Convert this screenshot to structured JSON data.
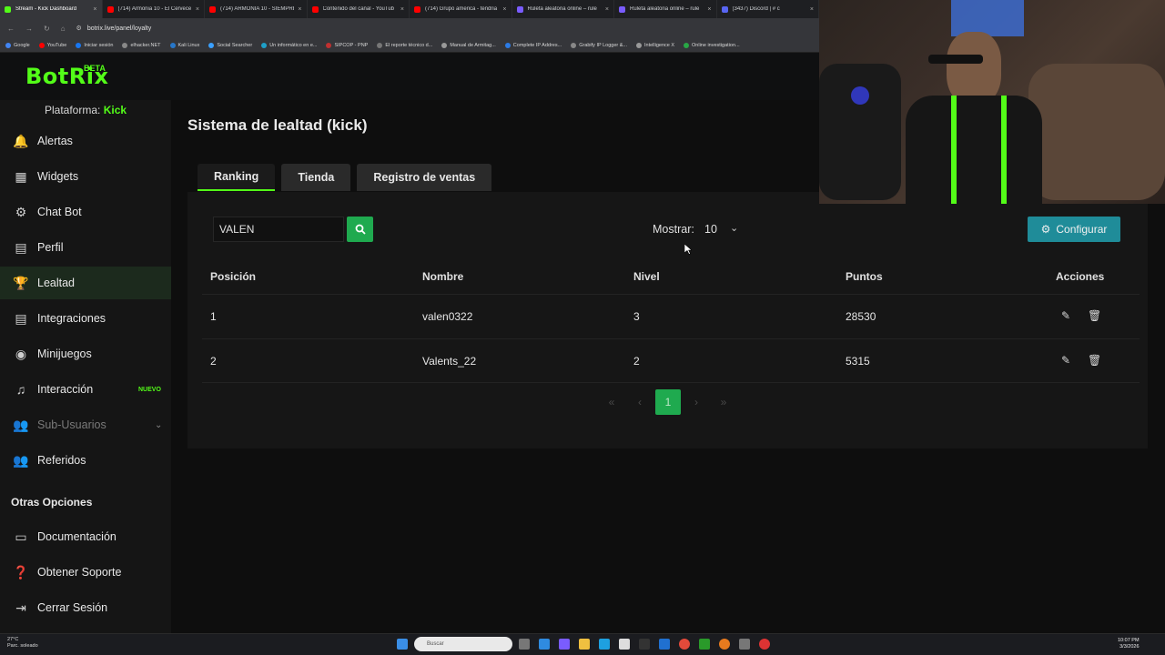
{
  "browser": {
    "tabs": [
      {
        "title": "Stream - Kick Dashboard",
        "color": "#53fc18"
      },
      {
        "title": "(714) Armonia 10 - El Cervece",
        "color": "#ff0000"
      },
      {
        "title": "(714) ARMONIA 10 - SIEMPRE",
        "color": "#ff0000"
      },
      {
        "title": "Contenido del canal - YouTub",
        "color": "#ff0000"
      },
      {
        "title": "(714) Grupo america - tendria",
        "color": "#ff0000"
      },
      {
        "title": "Ruleta aleatoria online – rule",
        "color": "#7a5cff"
      },
      {
        "title": "Ruleta aleatoria online – rule",
        "color": "#7a5cff"
      },
      {
        "title": "(3437) Discord | # c",
        "color": "#5865f2"
      }
    ],
    "url": "botrix.live/panel/loyalty",
    "bookmarks": [
      {
        "label": "Google",
        "color": "#4285f4"
      },
      {
        "label": "YouTube",
        "color": "#ff0000"
      },
      {
        "label": "Iniciar sesión",
        "color": "#1877f2"
      },
      {
        "label": "elhacker.NET",
        "color": "#888888"
      },
      {
        "label": "Kali Linux",
        "color": "#2777c9"
      },
      {
        "label": "Social Searcher",
        "color": "#3aa0ff"
      },
      {
        "label": "Un informático en e...",
        "color": "#1ea0c8"
      },
      {
        "label": "SIPCOP - PNP",
        "color": "#c03030"
      },
      {
        "label": "El reporte técnico d...",
        "color": "#777777"
      },
      {
        "label": "Manual de Armitag...",
        "color": "#999999"
      },
      {
        "label": "Complete IP Addres...",
        "color": "#2c7be5"
      },
      {
        "label": "Grabify IP Logger &...",
        "color": "#888888"
      },
      {
        "label": "Intelligence X",
        "color": "#999999"
      },
      {
        "label": "Online investigation...",
        "color": "#28a745"
      }
    ]
  },
  "app": {
    "logo": "BotRix",
    "logo_badge": "BETA",
    "platform_label": "Plataforma:",
    "platform_value": "Kick"
  },
  "sidebar": {
    "items": [
      {
        "label": "Alertas",
        "icon": "bell-icon",
        "glyph": "🔔"
      },
      {
        "label": "Widgets",
        "icon": "grid-icon",
        "glyph": "▦"
      },
      {
        "label": "Chat Bot",
        "icon": "robot-icon",
        "glyph": "🤖"
      },
      {
        "label": "Perfil",
        "icon": "id-card-icon",
        "glyph": "▤"
      },
      {
        "label": "Lealtad",
        "icon": "trophy-icon",
        "glyph": "🏆"
      },
      {
        "label": "Integraciones",
        "icon": "list-icon",
        "glyph": "▤"
      },
      {
        "label": "Minijuegos",
        "icon": "gamepad-icon",
        "glyph": "🎮"
      },
      {
        "label": "Interacción",
        "icon": "music-icon",
        "glyph": "♫",
        "badge": "NUEVO"
      },
      {
        "label": "Sub-Usuarios",
        "icon": "users-icon",
        "glyph": "👥"
      },
      {
        "label": "Referidos",
        "icon": "user-group-icon",
        "glyph": "👥"
      }
    ],
    "other_title": "Otras Opciones",
    "other_items": [
      {
        "label": "Documentación",
        "icon": "book-icon",
        "glyph": "📖"
      },
      {
        "label": "Obtener Soporte",
        "icon": "help-icon",
        "glyph": "?"
      },
      {
        "label": "Cerrar Sesión",
        "icon": "logout-icon",
        "glyph": "⇥"
      }
    ]
  },
  "main": {
    "title": "Sistema de lealtad (kick)",
    "tabs": [
      {
        "label": "Ranking",
        "active": true
      },
      {
        "label": "Tienda",
        "active": false
      },
      {
        "label": "Registro de ventas",
        "active": false
      }
    ],
    "search_value": "VALEN",
    "show_label": "Mostrar:",
    "show_value": "10",
    "configure_label": "Configurar",
    "table": {
      "headers": [
        "Posición",
        "Nombre",
        "Nivel",
        "Puntos",
        "Acciones"
      ],
      "rows": [
        {
          "pos": "1",
          "name": "valen0322",
          "level": "3",
          "points": "28530"
        },
        {
          "pos": "2",
          "name": "Valents_22",
          "level": "2",
          "points": "5315"
        }
      ]
    },
    "pagination": {
      "first": "«",
      "prev": "‹",
      "current": "1",
      "next": "›",
      "last": "»"
    }
  },
  "taskbar": {
    "temp": "27°C",
    "weather": "Parc. soleado",
    "search_placeholder": "Buscar",
    "time": "10:07 PM",
    "date": "3/3/2026"
  }
}
